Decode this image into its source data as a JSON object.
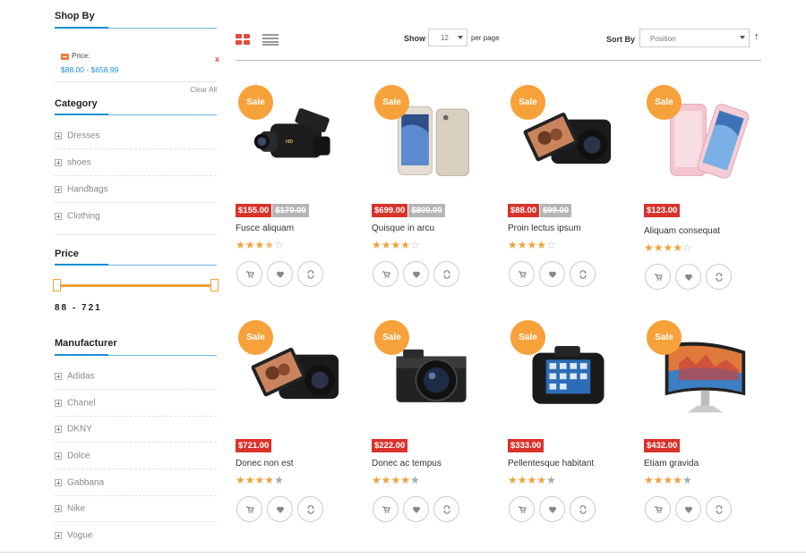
{
  "sidebar": {
    "shop_by": {
      "title": "Shop By",
      "filter_label": "Price:",
      "filter_value": "$88.00 - $658.99",
      "remove_icon": "x",
      "clear_all": "Clear All"
    },
    "category": {
      "title": "Category",
      "items": [
        "Dresses",
        "shoes",
        "Handbags",
        "Clothing"
      ]
    },
    "price": {
      "title": "Price",
      "range_text": "88 - 721",
      "slider_min_fraction": 0,
      "slider_max_fraction": 1
    },
    "manufacturer": {
      "title": "Manufacturer",
      "items": [
        "Adidas",
        "Chanel",
        "DKNY",
        "Dolce",
        "Gabbana",
        "Nike",
        "Vogue"
      ]
    }
  },
  "toolbar": {
    "grid_icon": "grid-view-icon",
    "list_icon": "list-view-icon",
    "show_label": "Show",
    "show_value": "12",
    "per_page": "per page",
    "sort_label": "Sort By",
    "sort_value": "Position",
    "sort_direction": "↑"
  },
  "colors": {
    "accent_orange": "#f7a13a",
    "price_red": "#d9332b",
    "old_price_gray": "#b5b5b5",
    "link_blue": "#1a8fd1",
    "grid_icon_red": "#e24c3c"
  },
  "products": [
    {
      "badge": "Sale",
      "image": "camcorder",
      "price": "$155.00",
      "old_price": "$170.00",
      "name": "Fusce aliquam",
      "rating": 3.5,
      "star_style": "outline"
    },
    {
      "badge": "Sale",
      "image": "smartphone-gold",
      "price": "$699.00",
      "old_price": "$800.00",
      "name": "Quisque in arcu",
      "rating": 4,
      "star_style": "outline"
    },
    {
      "badge": "Sale",
      "image": "flip-screen-camera",
      "price": "$88.00",
      "old_price": "$99.00",
      "name": "Proin lectus ipsum",
      "rating": 4,
      "star_style": "outline"
    },
    {
      "badge": "Sale",
      "image": "pink-phone-case",
      "price": "$123.00",
      "old_price": "",
      "name": "Aliquam consequat",
      "rating": 4,
      "star_style": "outline"
    },
    {
      "badge": "Sale",
      "image": "flip-screen-camera",
      "price": "$721.00",
      "old_price": "",
      "name": "Donec non est",
      "rating": 4,
      "star_style": "solid"
    },
    {
      "badge": "Sale",
      "image": "mirrorless-camera",
      "price": "$222.00",
      "old_price": "",
      "name": "Donec ac tempus",
      "rating": 4,
      "star_style": "solid"
    },
    {
      "badge": "Sale",
      "image": "smart-camera",
      "price": "$333.00",
      "old_price": "",
      "name": "Pellentesque habitant",
      "rating": 4,
      "star_style": "solid"
    },
    {
      "badge": "Sale",
      "image": "curved-monitor",
      "price": "$432.00",
      "old_price": "",
      "name": "Etiam gravida",
      "rating": 4,
      "star_style": "solid"
    }
  ],
  "product_actions": [
    "add-to-cart-icon",
    "wishlist-heart-icon",
    "compare-icon"
  ]
}
